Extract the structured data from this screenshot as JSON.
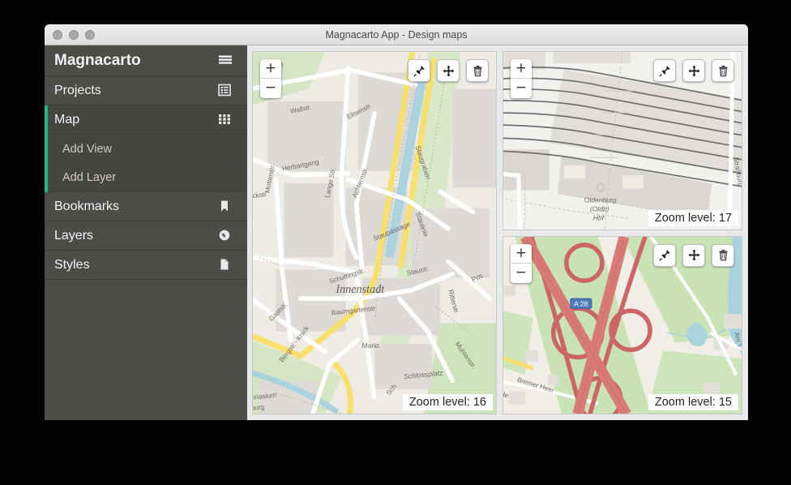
{
  "window": {
    "title": "Magnacarto App - Design maps",
    "traffic_lights": [
      "close",
      "minimize",
      "zoom"
    ]
  },
  "sidebar": {
    "brand": "Magnacarto",
    "brand_icon": "hamburger-menu-icon",
    "items": [
      {
        "label": "Projects",
        "icon": "list-box-icon",
        "active": false
      },
      {
        "label": "Map",
        "icon": "grid-icon",
        "active": true,
        "children": [
          {
            "label": "Add View"
          },
          {
            "label": "Add Layer"
          }
        ]
      },
      {
        "label": "Bookmarks",
        "icon": "bookmark-icon",
        "active": false
      },
      {
        "label": "Layers",
        "icon": "globe-icon",
        "active": false
      },
      {
        "label": "Styles",
        "icon": "document-icon",
        "active": false
      }
    ],
    "accent_color": "#14b98c",
    "background_color": "#4e4c49"
  },
  "map_tools": {
    "zoom_in_label": "+",
    "zoom_out_label": "−",
    "buttons": [
      {
        "name": "pin-button",
        "icon": "pin-icon"
      },
      {
        "name": "move-button",
        "icon": "move-arrows-icon"
      },
      {
        "name": "delete-button",
        "icon": "trash-icon"
      }
    ]
  },
  "panels": [
    {
      "id": "map-panel-innenstadt",
      "zoom_label": "Zoom level: 16",
      "zoom_level": 16,
      "place_labels": [
        "Innenstadt",
        "Schlossplatz"
      ],
      "street_labels": [
        "Wall",
        "Wallstr.",
        "Herbartgang",
        "Elisenstr.",
        "Mottenstr.",
        "Lange Str.",
        "Achternstr.",
        "Staupassage",
        "Staugraben",
        "Staulinie",
        "Staustr.",
        "Gaststr.",
        "Bergstr.- Knick",
        "Schuttingstr.",
        "Baumgartenstr.",
        "Markt",
        "Ritterstr.",
        "Muhlenstr.",
        "Pos",
        "Gymnasium",
        "burg",
        "Sch"
      ]
    },
    {
      "id": "map-panel-hauptbahnhof",
      "zoom_label": "Zoom level: 17",
      "zoom_level": 17,
      "place_labels": [
        "Oldenburg",
        "(Oldb)",
        "Hbf"
      ],
      "street_labels": [
        "Straßburg"
      ]
    },
    {
      "id": "map-panel-autobahn",
      "zoom_label": "Zoom level: 15",
      "zoom_level": 15,
      "road_shield": "A 28",
      "street_labels": [
        "Bremer Heer",
        "de",
        "Am T"
      ]
    }
  ],
  "colors": {
    "accent": "#14b98c",
    "sidebar_bg": "#4e4c49",
    "sidebar_sub_bg": "#474542",
    "map_bg": "#efece6",
    "water": "#aad3df",
    "green": "#c9e3b5",
    "motorway": "#d87a76",
    "primary_road": "#f7e06e",
    "shield_blue": "#4a7dbd"
  }
}
